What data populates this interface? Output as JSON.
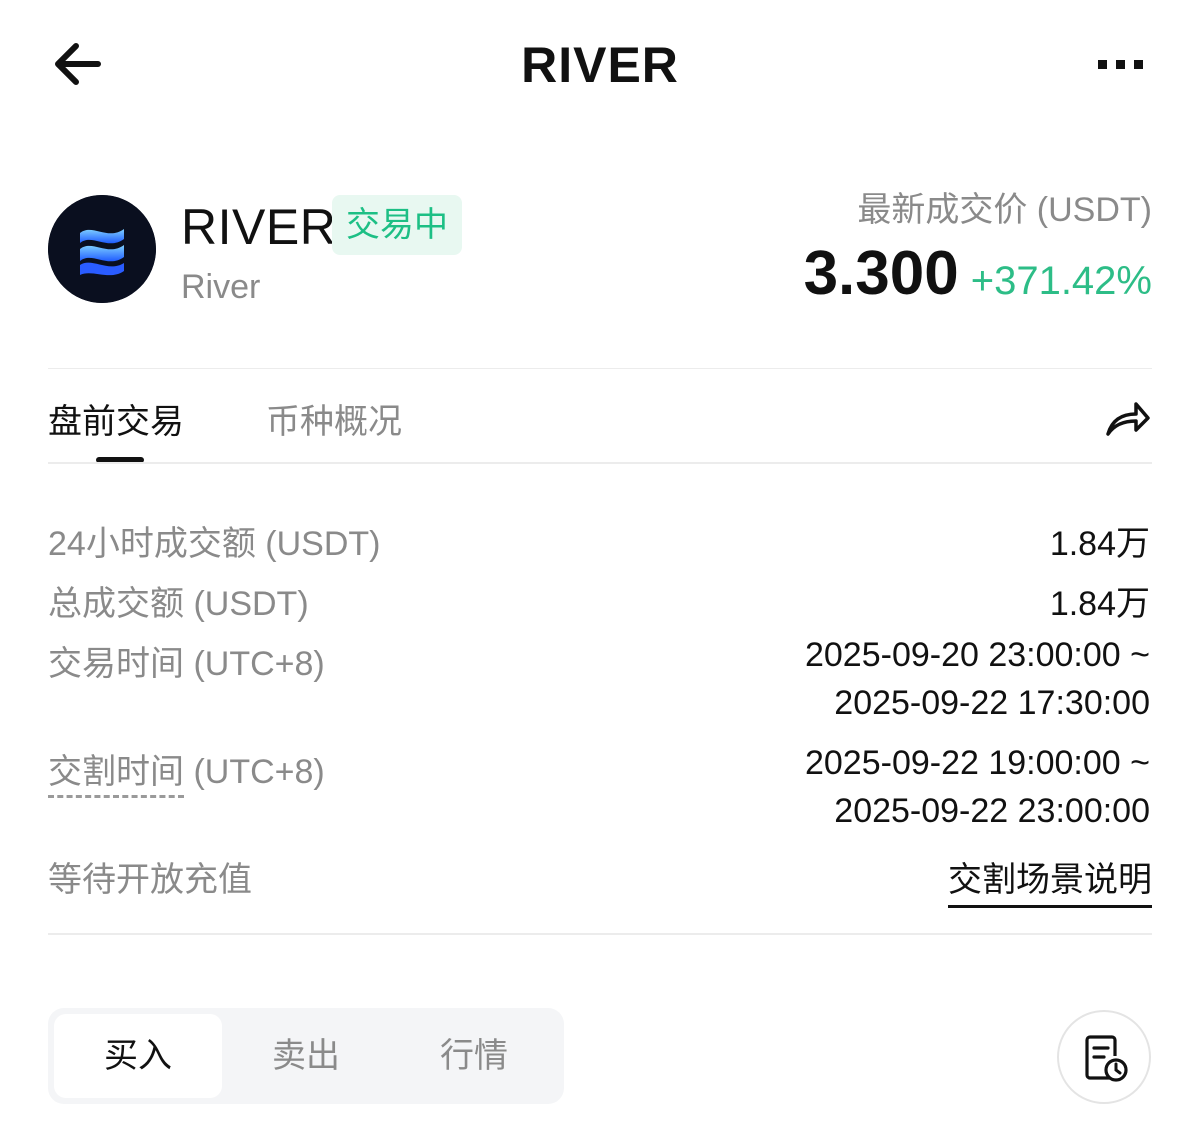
{
  "header": {
    "title": "RIVER",
    "back_icon": "arrow-left-icon",
    "more_icon": "more-dots-icon"
  },
  "coin": {
    "logo_icon": "river-logo-icon",
    "symbol": "RIVER",
    "status_badge": "交易中",
    "name": "River",
    "price_label": "最新成交价 (USDT)",
    "price": "3.300",
    "change": "+371.42%"
  },
  "tabs": [
    {
      "label": "盘前交易",
      "active": true
    },
    {
      "label": "币种概况",
      "active": false
    }
  ],
  "share_icon": "share-icon",
  "info": {
    "volume_24h_label": "24小时成交额 (USDT)",
    "volume_24h_value": "1.84万",
    "total_volume_label": "总成交额 (USDT)",
    "total_volume_value": "1.84万",
    "trading_time_label_main": "交易时间",
    "trading_time_label_tz": " (UTC+8)",
    "trading_time_start": "2025-09-20 23:00:00 ~",
    "trading_time_end": "2025-09-22 17:30:00",
    "delivery_time_label_main": "交割时间",
    "delivery_time_label_tz": " (UTC+8)",
    "delivery_time_start": "2025-09-22 19:00:00 ~",
    "delivery_time_end": "2025-09-22 23:00:00",
    "deposit_status": "等待开放充值",
    "delivery_scenario_link": "交割场景说明"
  },
  "actions": {
    "buy": "买入",
    "sell": "卖出",
    "market": "行情",
    "active": "买入",
    "history_icon": "order-history-icon"
  },
  "colors": {
    "up": "#2dbd87",
    "badge_bg": "#e8f8f1",
    "badge_text": "#1dbf85",
    "muted": "#8a8a8a"
  }
}
